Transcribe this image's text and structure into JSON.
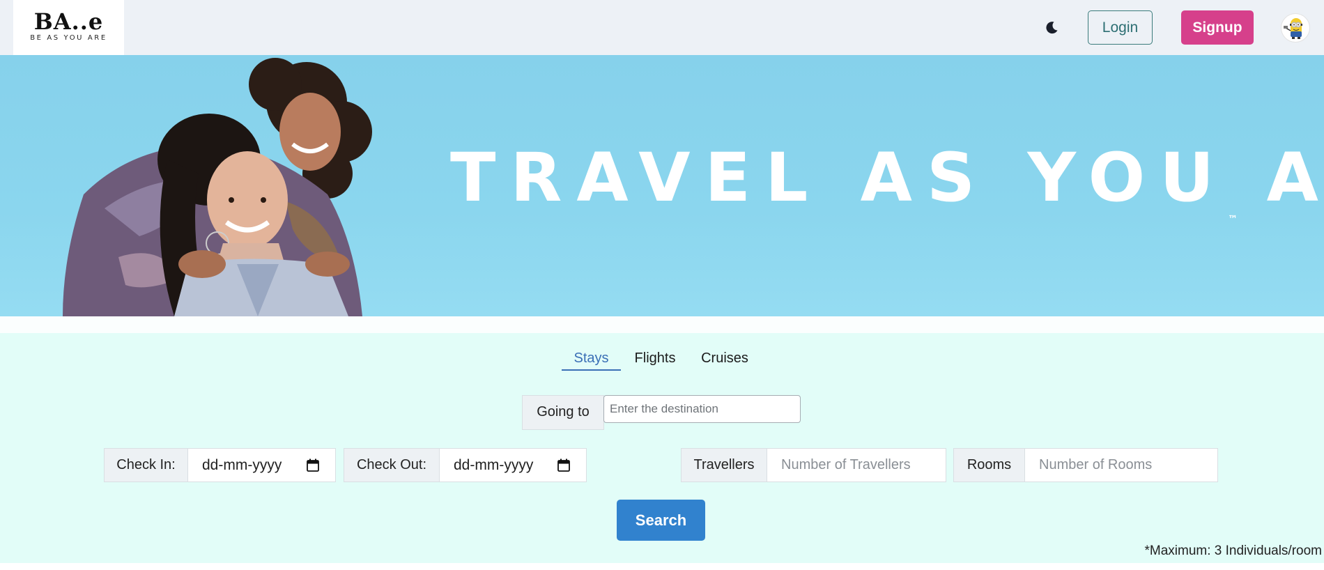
{
  "navbar": {
    "logo_mark": "BA..e",
    "logo_tagline": "BE AS YOU ARE",
    "theme_icon": "moon-icon",
    "login_label": "Login",
    "signup_label": "Signup",
    "avatar_icon": "minion-avatar",
    "colors": {
      "background": "#edf1f6",
      "signup": "#d6408b",
      "login_border": "#3a7b7b"
    }
  },
  "hero": {
    "title": "TRAVEL AS YOU ARE",
    "trademark": "™",
    "background": "#86d1eb"
  },
  "search": {
    "tabs": [
      {
        "label": "Stays",
        "active": true
      },
      {
        "label": "Flights",
        "active": false
      },
      {
        "label": "Cruises",
        "active": false
      }
    ],
    "going_to_label": "Going to",
    "destination_placeholder": "Enter the destination",
    "check_in_label": "Check In:",
    "check_in_value": "dd-mm-yyyy",
    "check_out_label": "Check Out:",
    "check_out_value": "dd-mm-yyyy",
    "travellers_label": "Travellers",
    "travellers_placeholder": "Number of Travellers",
    "rooms_label": "Rooms",
    "rooms_placeholder": "Number of Rooms",
    "search_label": "Search",
    "note": "*Maximum: 3 Individuals/room",
    "colors": {
      "section_background": "#e2fdf8",
      "accent": "#3a6fb6",
      "search_button": "#3182ce"
    }
  }
}
